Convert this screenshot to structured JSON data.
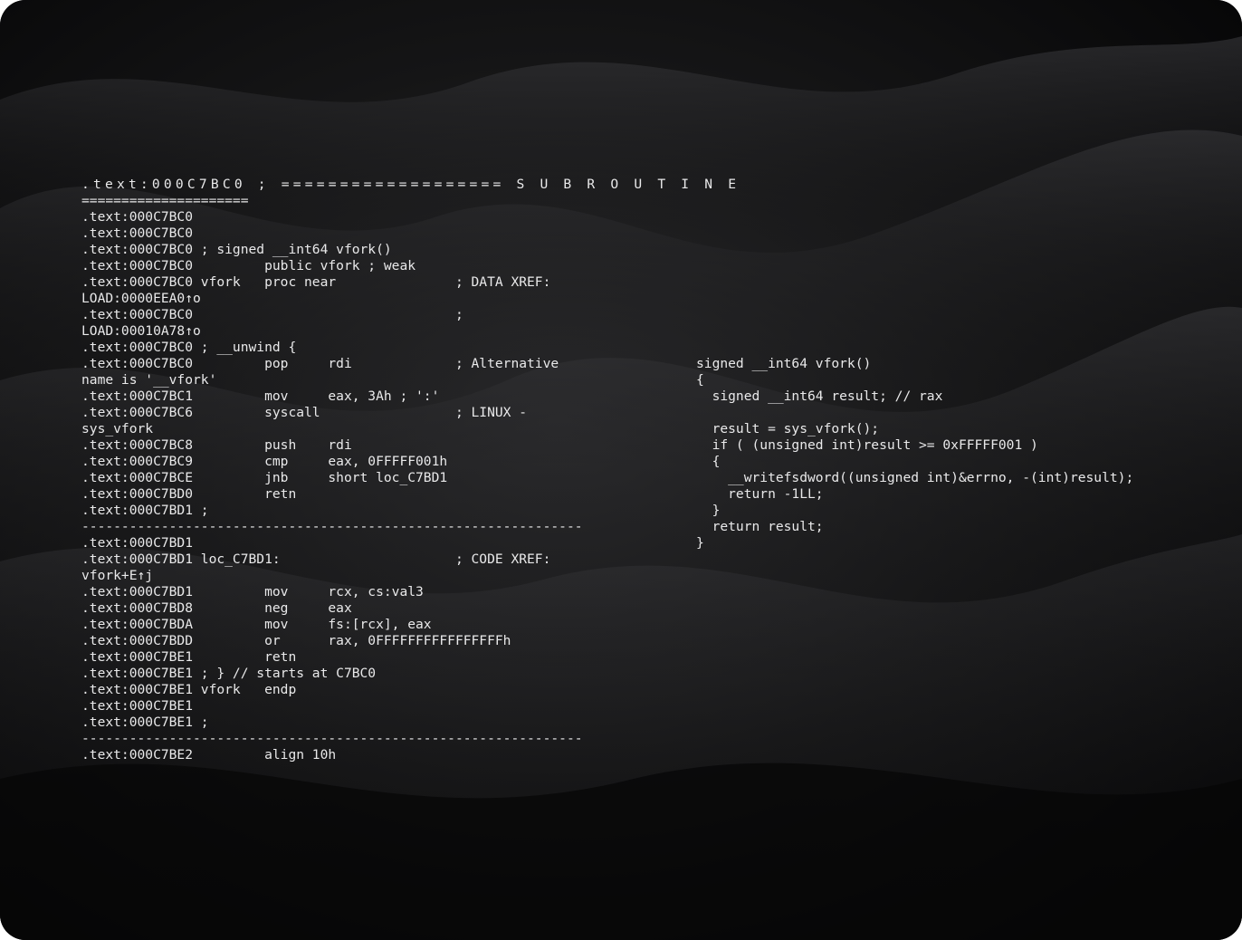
{
  "asm_listing": {
    "lines": [
      ".text:000C7BC0 ; =================== S U B R O U T I N E",
      "=====================",
      ".text:000C7BC0",
      ".text:000C7BC0",
      ".text:000C7BC0 ; signed __int64 vfork()",
      ".text:000C7BC0         public vfork ; weak",
      ".text:000C7BC0 vfork   proc near               ; DATA XREF:",
      "LOAD:0000EEA0↑o",
      ".text:000C7BC0                                 ;",
      "LOAD:00010A78↑o",
      ".text:000C7BC0 ; __unwind {",
      ".text:000C7BC0         pop     rdi             ; Alternative",
      "name is '__vfork'",
      ".text:000C7BC1         mov     eax, 3Ah ; ':'",
      ".text:000C7BC6         syscall                 ; LINUX -",
      "sys_vfork",
      ".text:000C7BC8         push    rdi",
      ".text:000C7BC9         cmp     eax, 0FFFFF001h",
      ".text:000C7BCE         jnb     short loc_C7BD1",
      ".text:000C7BD0         retn",
      ".text:000C7BD1 ;",
      "---------------------------------------------------------------",
      ".text:000C7BD1",
      ".text:000C7BD1 loc_C7BD1:                      ; CODE XREF:",
      "vfork+E↑j",
      ".text:000C7BD1         mov     rcx, cs:val3",
      ".text:000C7BD8         neg     eax",
      ".text:000C7BDA         mov     fs:[rcx], eax",
      ".text:000C7BDD         or      rax, 0FFFFFFFFFFFFFFFFh",
      ".text:000C7BE1         retn",
      ".text:000C7BE1 ; } // starts at C7BC0",
      ".text:000C7BE1 vfork   endp",
      ".text:000C7BE1",
      ".text:000C7BE1 ;",
      "---------------------------------------------------------------",
      ".text:000C7BE2         align 10h"
    ]
  },
  "pseudocode": {
    "lines": [
      "signed __int64 vfork()",
      "{",
      "  signed __int64 result; // rax",
      "",
      "  result = sys_vfork();",
      "  if ( (unsigned int)result >= 0xFFFFF001 )",
      "  {",
      "    __writefsdword((unsigned int)&errno, -(int)result);",
      "    return -1LL;",
      "  }",
      "  return result;",
      "}"
    ]
  },
  "colors": {
    "background": "#0b0b0c",
    "text": "#e9e9ea"
  }
}
